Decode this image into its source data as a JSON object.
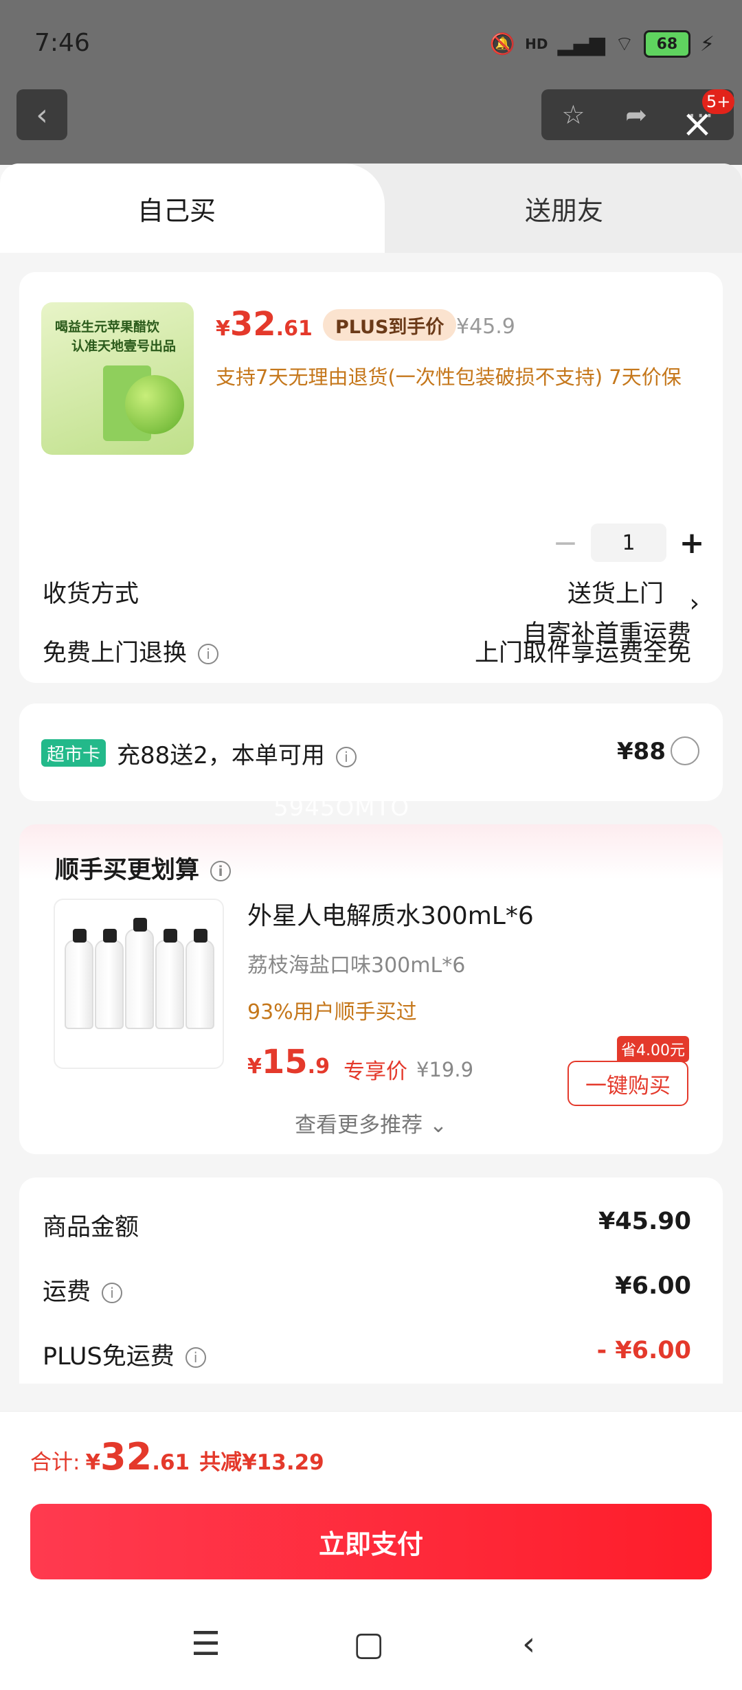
{
  "status_bar": {
    "time": "7:46",
    "battery": "68",
    "net": "HD"
  },
  "bg_nav": {
    "back_glyph": "‹",
    "badge": "5+"
  },
  "tabs": [
    {
      "label": "自己买",
      "active": true
    },
    {
      "label": "送朋友",
      "active": false
    }
  ],
  "product": {
    "image_text": [
      "喝益生元苹果醋饮",
      "认准天地壹号出品"
    ],
    "price_yen": "¥",
    "price_int": "32",
    "price_dec": ".61",
    "plus_badge": "PLUS到手价",
    "original_price": "¥45.9",
    "service": "支持7天无理由退货(一次性包装破损不支持) 7天价保",
    "qty_minus": "−",
    "quantity": "1",
    "qty_plus": "+"
  },
  "delivery": {
    "label": "收货方式",
    "value": "送货上门",
    "chevron": "›"
  },
  "returns": {
    "label": "免费上门退换",
    "value_line1": "上门取件享运费全免",
    "value_line2": "自寄补首重运费"
  },
  "market": {
    "tag": "超市卡",
    "text": "充88送2，本单可用",
    "price": "¥88"
  },
  "watermark": "5945OMTO",
  "recommend": {
    "title": "顺手买更划算",
    "name": "外星人电解质水300mL*6",
    "spec": "荔枝海盐口味300mL*6",
    "stat": "93%用户顺手买过",
    "price_yen": "¥",
    "price_int": "15",
    "price_dec": ".9",
    "tag": "专享价",
    "original_price": "¥19.9",
    "save_badge": "省4.00元",
    "buy_label": "一键购买",
    "more": "查看更多推荐",
    "more_chevron": "⌄"
  },
  "summary": [
    {
      "label": "商品金额",
      "value": "¥45.90",
      "info": false,
      "red": false
    },
    {
      "label": "运费",
      "value": "¥6.00",
      "info": true,
      "red": false
    },
    {
      "label": "PLUS免运费",
      "value": "- ¥6.00",
      "info": true,
      "red": true
    }
  ],
  "footer": {
    "total_label": "合计:",
    "total_yen": "¥",
    "total_int": "32",
    "total_dec": ".61",
    "total_save": "共减¥13.29",
    "pay_label": "立即支付"
  },
  "colors": {
    "accent": "#e4392b",
    "service": "#c5771b",
    "market_tag": "#23b98a"
  },
  "icons": {
    "close": "close-icon",
    "info": "info-icon",
    "star": "star-icon",
    "share": "share-icon",
    "more": "more-icon"
  }
}
